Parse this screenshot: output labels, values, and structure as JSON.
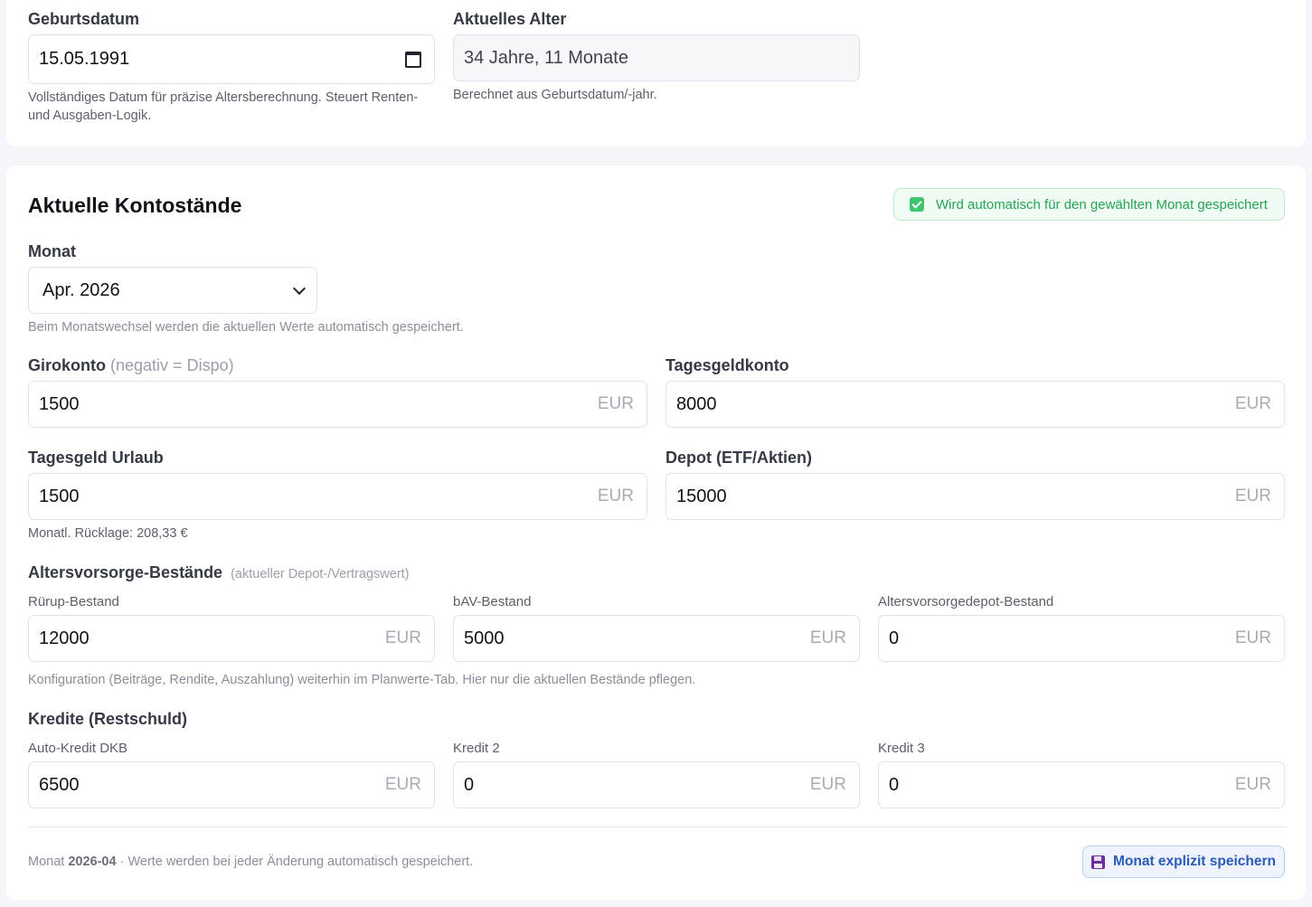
{
  "birth": {
    "label": "Geburtsdatum",
    "value": "15.05.1991",
    "hint": "Vollständiges Datum für präzise Altersberechnung. Steuert Renten- und Ausgaben-Logik."
  },
  "age": {
    "label": "Aktuelles Alter",
    "value": "34 Jahre, 11 Monate",
    "hint": "Berechnet aus Geburtsdatum/-jahr."
  },
  "balances": {
    "title": "Aktuelle Kontostände",
    "autosave_badge": "Wird automatisch für den gewählten Monat gespeichert",
    "month_label": "Monat",
    "month_value": "Apr. 2026",
    "month_hint": "Beim Monatswechsel werden die aktuellen Werte automatisch gespeichert.",
    "unit": "EUR",
    "giro": {
      "label": "Girokonto",
      "note": "(negativ = Dispo)",
      "value": "1500"
    },
    "tagesgeld": {
      "label": "Tagesgeldkonto",
      "value": "8000"
    },
    "urlaub": {
      "label": "Tagesgeld Urlaub",
      "value": "1500",
      "hint": "Monatl. Rücklage: 208,33 €"
    },
    "depot": {
      "label": "Depot (ETF/Aktien)",
      "value": "15000"
    },
    "pension": {
      "title": "Altersvorsorge-Bestände",
      "note": "(aktueller Depot-/Vertragswert)",
      "ruerup": {
        "label": "Rürup-Bestand",
        "value": "12000"
      },
      "bav": {
        "label": "bAV-Bestand",
        "value": "5000"
      },
      "avdepot": {
        "label": "Altersvorsorgedepot-Bestand",
        "value": "0"
      },
      "hint": "Konfiguration (Beiträge, Rendite, Auszahlung) weiterhin im Planwerte-Tab. Hier nur die aktuellen Bestände pflegen."
    },
    "loans": {
      "title": "Kredite (Restschuld)",
      "auto": {
        "label": "Auto-Kredit DKB",
        "value": "6500"
      },
      "k2": {
        "label": "Kredit 2",
        "value": "0"
      },
      "k3": {
        "label": "Kredit 3",
        "value": "0"
      }
    },
    "footer": {
      "prefix": "Monat",
      "month": "2026-04",
      "suffix": "· Werte werden bei jeder Änderung automatisch gespeichert.",
      "save_label": "Monat explizit speichern"
    }
  }
}
